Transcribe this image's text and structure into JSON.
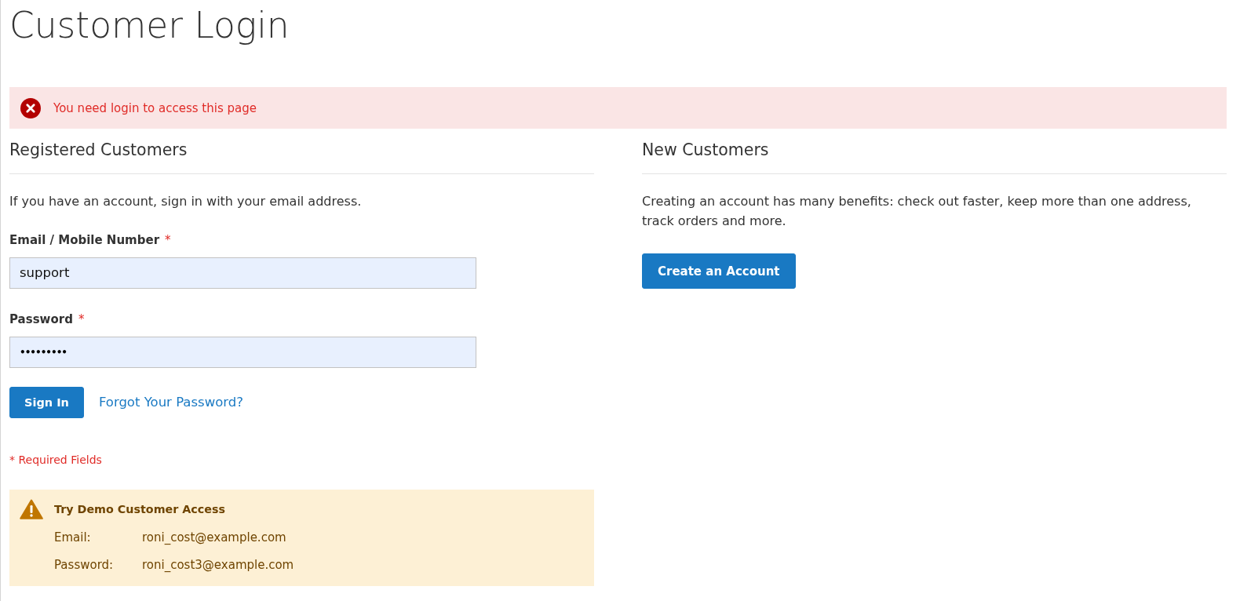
{
  "page_title": "Customer Login",
  "message": {
    "kind": "error",
    "text": "You need login to access this page"
  },
  "registered_customers": {
    "heading": "Registered Customers",
    "intro": "If you have an account, sign in with your email address.",
    "fields": [
      {
        "kind": "text",
        "label": "Email / Mobile Number",
        "required_mark": "*",
        "value": "support"
      },
      {
        "kind": "password",
        "label": "Password",
        "required_mark": "*",
        "value": "•••••••••"
      }
    ],
    "sign_in_button": "Sign In",
    "forgot_password_link": "Forgot Your Password?",
    "required_note": "* Required Fields",
    "demo_notice": {
      "kind": "warning",
      "title": "Try Demo Customer Access",
      "rows": [
        {
          "label": "Email:",
          "value": "roni_cost@example.com"
        },
        {
          "label": "Password:",
          "value": "roni_cost3@example.com"
        }
      ]
    }
  },
  "new_customers": {
    "heading": "New Customers",
    "text": "Creating an account has many benefits: check out faster, keep more than one address, track orders and more.",
    "create_account_button": "Create an Account"
  }
}
